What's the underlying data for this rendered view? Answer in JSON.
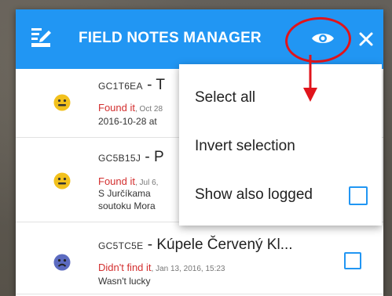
{
  "header": {
    "title": "FIELD NOTES MANAGER",
    "icons": [
      "edit-list-icon",
      "eye-icon",
      "close-icon"
    ]
  },
  "notes": [
    {
      "code": "GC1T6EA",
      "separator": " - ",
      "name": "T",
      "status": "Found it",
      "date": ", Oct 28",
      "note": "2016-10-28 at",
      "face": "happy"
    },
    {
      "code": "GC5B15J",
      "separator": " - ",
      "name": "P",
      "status": "Found it",
      "date": ", Jul 6,",
      "note_line1": "S Jurčíkama",
      "note_line2": "soutoku Mora",
      "face": "happy"
    },
    {
      "code": "GC5TC5E",
      "separator": " - ",
      "name": "Kúpele Červený Kl...",
      "status": "Didn't find it",
      "date": ", Jan 13, 2016, 15:23",
      "note": "Wasn't lucky",
      "face": "sad"
    }
  ],
  "menu": {
    "items": [
      "Select all",
      "Invert selection",
      "Show also logged"
    ]
  },
  "colors": {
    "header": "#2196f3",
    "accent": "#2196f3",
    "found": "#d32f2f",
    "annotation": "#e0141b",
    "happy_face": "#f2c11d",
    "sad_face": "#5c6bc0"
  }
}
